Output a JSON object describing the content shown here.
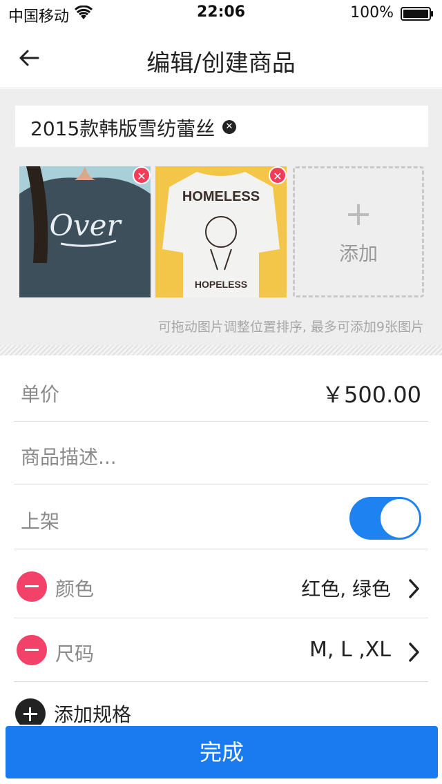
{
  "status_bar": {
    "carrier": "中国移动",
    "time": "22:06",
    "battery": "100%"
  },
  "nav": {
    "title": "编辑/创建商品",
    "back_icon": "arrow-left-icon"
  },
  "product": {
    "name": "2015款韩版雪纺蕾丝",
    "images": [
      {
        "name": "sweatshirt-image",
        "print": "Over"
      },
      {
        "name": "tshirt-image",
        "print_top": "HOMELESS",
        "print_bottom": "HOPELESS"
      }
    ],
    "add_label": "添加",
    "hint": "可拖动图片调整位置排序, 最多可添加9张图片"
  },
  "fields": {
    "price_label": "单价",
    "price_value": "￥500.00",
    "desc_placeholder": "商品描述...",
    "listed_label": "上架",
    "listed_on": true,
    "color_label": "颜色",
    "color_value": "红色, 绿色",
    "size_label": "尺码",
    "size_value": "M, L ,XL",
    "add_spec_label": "添加规格"
  },
  "done_label": "完成",
  "colors": {
    "accent": "#1a7bf0",
    "delete": "#f2426a"
  }
}
